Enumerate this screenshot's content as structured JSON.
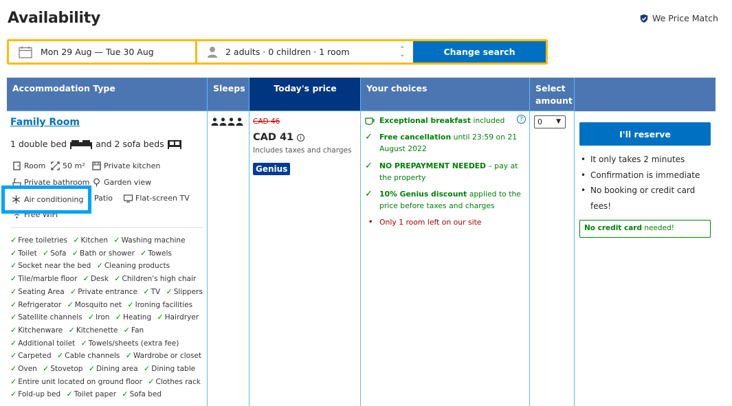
{
  "page": {
    "title": "Availability",
    "price_match": "We Price Match"
  },
  "search": {
    "dates": "Mon 29 Aug — Tue 30 Aug",
    "guests": "2 adults · 0 children · 1 room",
    "button": "Change search"
  },
  "table": {
    "headers": {
      "type": "Accommodation Type",
      "sleeps": "Sleeps",
      "price": "Today's price",
      "choices": "Your choices",
      "select_1": "Select",
      "select_2": "amount"
    }
  },
  "room": {
    "name": "Family Room",
    "beds_1": "1 double bed",
    "beds_2": "and 2 sofa beds",
    "facilities": {
      "room": "Room",
      "size": "50 m²",
      "kitchen": "Private kitchen",
      "bathroom": "Private bathroom",
      "garden": "Garden view",
      "aircon": "Air conditioning",
      "patio": "Patio",
      "tv": "Flat-screen TV",
      "wifi": "Free WiFi"
    },
    "amenities": [
      "Free toiletries",
      "Kitchen",
      "Washing machine",
      "Toilet",
      "Sofa",
      "Bath or shower",
      "Towels",
      "Socket near the bed",
      "Cleaning products",
      "Tile/marble floor",
      "Desk",
      "Children's high chair",
      "Seating Area",
      "Private entrance",
      "TV",
      "Slippers",
      "Refrigerator",
      "Mosquito net",
      "Ironing facilities",
      "Satellite channels",
      "Iron",
      "Heating",
      "Hairdryer",
      "Kitchenware",
      "Kitchenette",
      "Fan",
      "Additional toilet",
      "Towels/sheets (extra fee)",
      "Carpeted",
      "Cable channels",
      "Wardrobe or closet",
      "Oven",
      "Stovetop",
      "Dining area",
      "Dining table",
      "Entire unit located on ground floor",
      "Clothes rack",
      "Fold-up bed",
      "Toilet paper",
      "Sofa bed"
    ],
    "sleeps_count": 4
  },
  "price": {
    "old": "CAD 46",
    "current": "CAD 41",
    "info_icon": "i",
    "taxes": "Includes taxes and charges",
    "badge": "Genius"
  },
  "choices": {
    "breakfast_bold": "Exceptional breakfast",
    "breakfast_rest": "included",
    "cancel_bold": "Free cancellation",
    "cancel_rest": "until 23:59 on 21 August 2022",
    "prepay_bold": "NO PREPAYMENT NEEDED",
    "prepay_rest": "– pay at the property",
    "genius_bold": "10% Genius discount",
    "genius_rest": "applied to the price before taxes and charges",
    "left": "Only 1 room left on our site",
    "help_icon": "?"
  },
  "select": {
    "value": "0"
  },
  "reserve": {
    "button": "I'll reserve",
    "bullets": [
      "It only takes 2 minutes",
      "Confirmation is immediate",
      "No booking or credit card fees!"
    ],
    "nocc_bold": "No credit card",
    "nocc_rest": "needed!"
  },
  "colors": {
    "brand_blue": "#0071c2",
    "header_blue": "#4c76b2",
    "dark_blue": "#003580",
    "yellow": "#febb02",
    "green": "#008009"
  }
}
